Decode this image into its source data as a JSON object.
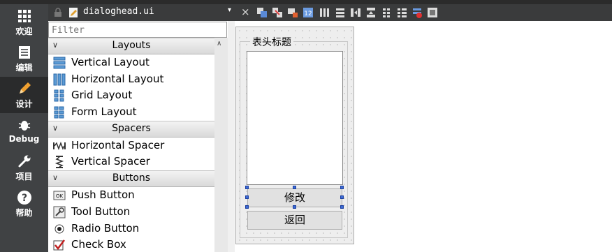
{
  "mode_bar": {
    "items": [
      {
        "label": "欢迎",
        "icon": "grid-icon"
      },
      {
        "label": "编辑",
        "icon": "document-icon"
      },
      {
        "label": "设计",
        "icon": "pencil-icon",
        "active": true
      },
      {
        "label": "Debug",
        "icon": "bug-icon"
      },
      {
        "label": "项目",
        "icon": "wrench-icon"
      },
      {
        "label": "帮助",
        "icon": "help-icon"
      }
    ]
  },
  "editor_toolbar": {
    "file_name": "dialoghead.ui",
    "close_symbol": "×",
    "combo_arrow": "▾",
    "tools": [
      "edit-widgets-icon",
      "edit-signals-slots-icon",
      "edit-buddies-icon",
      "edit-tab-order-icon",
      "layout-horizontal-icon",
      "layout-vertical-icon",
      "layout-horizontal-splitter-icon",
      "layout-vertical-splitter-icon",
      "layout-grid-icon",
      "layout-form-icon",
      "break-layout-icon",
      "adjust-size-icon"
    ]
  },
  "widget_box": {
    "filter_placeholder": "Filter",
    "categories": [
      {
        "name": "Layouts",
        "items": [
          "Vertical Layout",
          "Horizontal Layout",
          "Grid Layout",
          "Form Layout"
        ]
      },
      {
        "name": "Spacers",
        "items": [
          "Horizontal Spacer",
          "Vertical Spacer"
        ]
      },
      {
        "name": "Buttons",
        "items": [
          "Push Button",
          "Tool Button",
          "Radio Button",
          "Check Box"
        ]
      }
    ]
  },
  "form": {
    "group_title": "表头标题",
    "modify_button": "修改",
    "back_button": "返回"
  },
  "colors": {
    "mode_bar_bg": "#404244",
    "mode_active_bg": "#2a2b2c",
    "toolbar_bg": "#3a3b3c",
    "selection_handle": "#3c6bd6"
  }
}
